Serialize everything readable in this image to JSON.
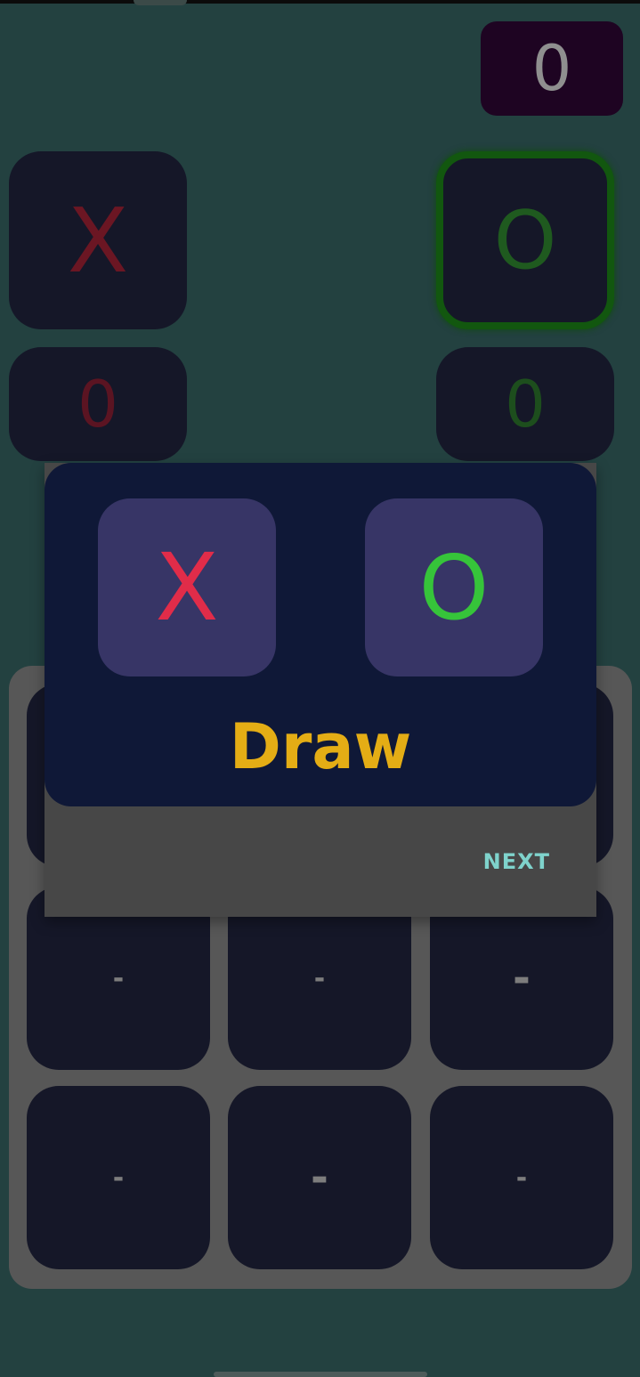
{
  "round": {
    "counter": "0"
  },
  "players": {
    "x": {
      "symbol": "X",
      "score": "0",
      "color": "#6b1623"
    },
    "o": {
      "symbol": "O",
      "score": "0",
      "color": "#1f5a1f",
      "active": true
    }
  },
  "board": {
    "cells": [
      "",
      "",
      "",
      "-",
      "-",
      "-",
      "-",
      "-",
      "-"
    ]
  },
  "dialog": {
    "symbols": {
      "x": "X",
      "o": "O"
    },
    "result": "Draw",
    "next_label": "NEXT",
    "colors": {
      "x": "#e12c49",
      "o": "#36c43a",
      "result": "#e4ad15",
      "button": "#7fd3cc"
    }
  }
}
